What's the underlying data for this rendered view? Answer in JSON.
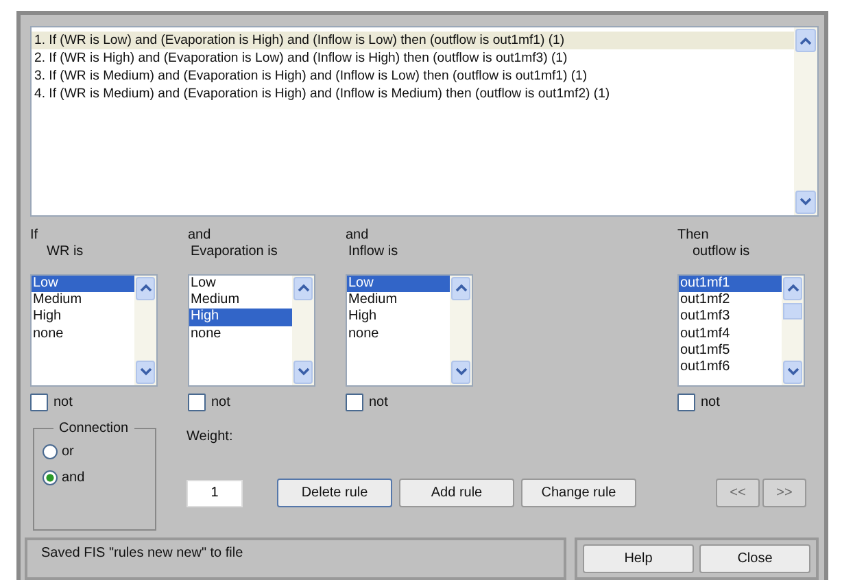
{
  "rules": {
    "items": [
      {
        "text": "1. If (WR is Low) and (Evaporation is High) and (Inflow is Low) then (outflow is out1mf1) (1)",
        "selected": true
      },
      {
        "text": "2. If (WR is High) and (Evaporation is Low) and (Inflow is High) then (outflow is out1mf3) (1)",
        "selected": false
      },
      {
        "text": "3. If (WR is Medium) and (Evaporation is High) and (Inflow is Low) then (outflow is out1mf1) (1)",
        "selected": false
      },
      {
        "text": "4. If (WR is Medium) and (Evaporation is High) and (Inflow is Medium) then (outflow is out1mf2) (1)",
        "selected": false
      }
    ]
  },
  "columns": [
    {
      "connector": "If",
      "label": "WR is",
      "options": [
        {
          "text": "Low",
          "selected": true
        },
        {
          "text": "Medium",
          "selected": false
        },
        {
          "text": "High",
          "selected": false
        },
        {
          "text": "none",
          "selected": false
        }
      ],
      "not_label": "not",
      "not_checked": false
    },
    {
      "connector": "and",
      "label": "Evaporation is",
      "options": [
        {
          "text": "Low",
          "selected": false
        },
        {
          "text": "Medium",
          "selected": false
        },
        {
          "text": "High",
          "selected": true
        },
        {
          "text": "none",
          "selected": false
        }
      ],
      "not_label": "not",
      "not_checked": false
    },
    {
      "connector": "and",
      "label": "Inflow is",
      "options": [
        {
          "text": "Low",
          "selected": true
        },
        {
          "text": "Medium",
          "selected": false
        },
        {
          "text": "High",
          "selected": false
        },
        {
          "text": "none",
          "selected": false
        }
      ],
      "not_label": "not",
      "not_checked": false
    },
    {
      "connector": "Then",
      "label": "outflow is",
      "options": [
        {
          "text": "out1mf1",
          "selected": true
        },
        {
          "text": "out1mf2",
          "selected": false
        },
        {
          "text": "out1mf3",
          "selected": false
        },
        {
          "text": "out1mf4",
          "selected": false
        },
        {
          "text": "out1mf5",
          "selected": false
        },
        {
          "text": "out1mf6",
          "selected": false
        }
      ],
      "not_label": "not",
      "not_checked": false
    }
  ],
  "connection": {
    "title": "Connection",
    "options": [
      {
        "label": "or",
        "selected": false
      },
      {
        "label": "and",
        "selected": true
      }
    ]
  },
  "weight": {
    "label": "Weight:",
    "value": "1"
  },
  "rule_buttons": [
    {
      "label": "Delete rule",
      "disabled": false
    },
    {
      "label": "Add rule",
      "disabled": false
    },
    {
      "label": "Change rule",
      "disabled": false
    }
  ],
  "nav_buttons": [
    {
      "label": "<<",
      "disabled": true
    },
    {
      "label": ">>",
      "disabled": true
    }
  ],
  "status_bar": "Saved FIS \"rules new new\" to file",
  "dialog_buttons": [
    {
      "label": "Help"
    },
    {
      "label": "Close"
    }
  ]
}
